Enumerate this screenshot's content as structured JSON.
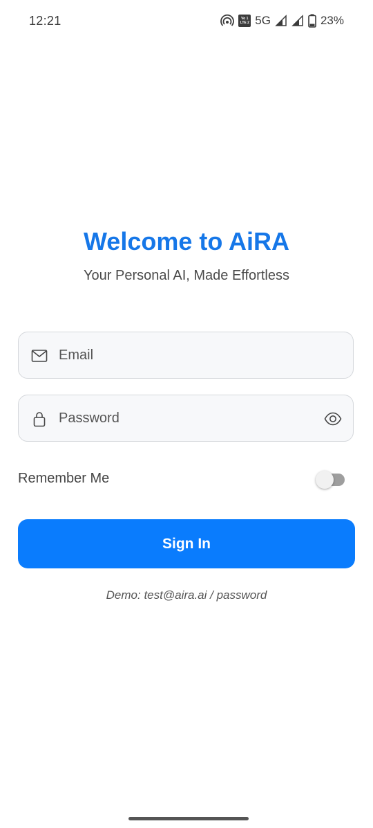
{
  "status_bar": {
    "time": "12:21",
    "volte_top": "Vo 1",
    "volte_bottom": "LTE 2",
    "network": "5G",
    "battery": "23%"
  },
  "header": {
    "title": "Welcome to AiRA",
    "subtitle": "Your Personal AI, Made Effortless"
  },
  "form": {
    "email": {
      "placeholder": "Email",
      "value": ""
    },
    "password": {
      "placeholder": "Password",
      "value": ""
    },
    "remember_label": "Remember Me",
    "remember_on": false,
    "signin_label": "Sign In"
  },
  "footer": {
    "demo_text": "Demo: test@aira.ai / password"
  },
  "colors": {
    "accent": "#0a7cfd",
    "title": "#1677e8"
  },
  "icons": {
    "email": "mail-icon",
    "password": "lock-icon",
    "toggle_visibility": "eye-icon"
  }
}
